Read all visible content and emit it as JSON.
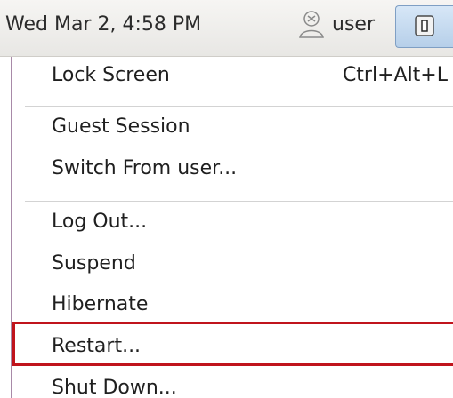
{
  "panel": {
    "clock": "Wed Mar  2,  4:58 PM",
    "user_name": "user",
    "user_icon": "user-icon",
    "power_icon": "power-icon"
  },
  "menu": {
    "lock_screen": "Lock Screen",
    "lock_shortcut": "Ctrl+Alt+L",
    "guest_session": "Guest Session",
    "switch_user": "Switch From user...",
    "log_out": "Log Out...",
    "suspend": "Suspend",
    "hibernate": "Hibernate",
    "restart": "Restart...",
    "shut_down": "Shut Down..."
  },
  "colors": {
    "highlight": "#c0141c",
    "power_button": "#b6cfe9"
  }
}
